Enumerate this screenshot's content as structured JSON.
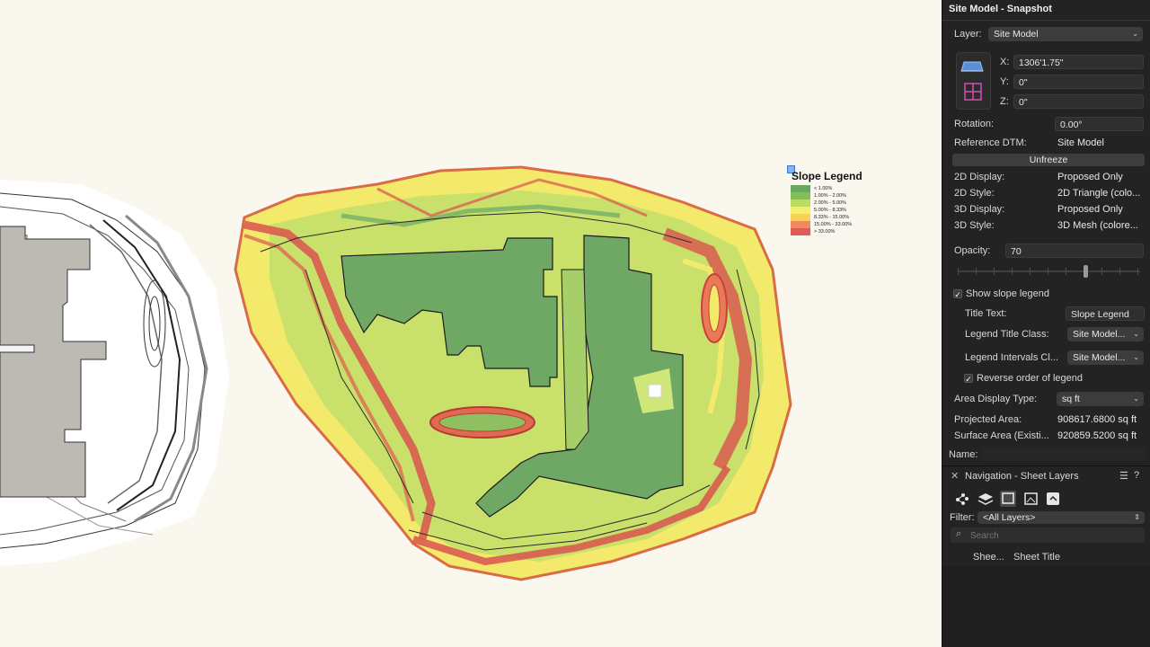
{
  "legend": {
    "title": "Slope Legend",
    "rows": [
      {
        "color": "#6aa862",
        "label": "< 1.00%"
      },
      {
        "color": "#82bd5e",
        "label": "1.00% -  2.00%"
      },
      {
        "color": "#b7dd63",
        "label": "2.00% -  5.00%"
      },
      {
        "color": "#f3f070",
        "label": "5.00% -  8.33%"
      },
      {
        "color": "#f5d258",
        "label": "8.33% - 15.00%"
      },
      {
        "color": "#ee8a5d",
        "label": "15.00% - 33.00%"
      },
      {
        "color": "#e05a57",
        "label": "> 33.00%"
      }
    ]
  },
  "panel": {
    "title": "Site Model - Snapshot",
    "layer_label": "Layer:",
    "layer_value": "Site Model",
    "x_label": "X:",
    "x_value": "1306'1.75\"",
    "y_label": "Y:",
    "y_value": "0\"",
    "z_label": "Z:",
    "z_value": "0\"",
    "rotation_label": "Rotation:",
    "rotation_value": "0.00°",
    "ref_dtm_label": "Reference DTM:",
    "ref_dtm_value": "Site Model",
    "unfreeze_label": "Unfreeze",
    "display2d_label": "2D Display:",
    "display2d_value": "Proposed Only",
    "style2d_label": "2D Style:",
    "style2d_value": "2D Triangle (colo...",
    "display3d_label": "3D Display:",
    "display3d_value": "Proposed Only",
    "style3d_label": "3D Style:",
    "style3d_value": "3D Mesh (colore...",
    "opacity_label": "Opacity:",
    "opacity_value": "70",
    "opacity_fraction": 0.7,
    "show_slope_label": "Show slope legend",
    "title_text_label": "Title Text:",
    "title_text_value": "Slope Legend",
    "legend_title_class_label": "Legend Title Class:",
    "legend_title_class_value": "Site Model...",
    "legend_intervals_label": "Legend Intervals Cl...",
    "legend_intervals_value": "Site Model...",
    "reverse_label": "Reverse order of legend",
    "area_type_label": "Area Display Type:",
    "area_type_value": "sq ft",
    "projected_area_label": "Projected Area:",
    "projected_area_value": "908617.6800 sq ft",
    "surface_area_label": "Surface Area (Existi...",
    "surface_area_value": "920859.5200 sq ft",
    "name_label": "Name:"
  },
  "nav": {
    "title": "Navigation - Sheet Layers",
    "filter_label": "Filter:",
    "filter_value": "<All Layers>",
    "search_placeholder": "Search",
    "col_sheet": "Shee...",
    "col_title": "Sheet Title",
    "close_glyph": "✕",
    "menu_glyph": "☰",
    "help_glyph": "?"
  }
}
